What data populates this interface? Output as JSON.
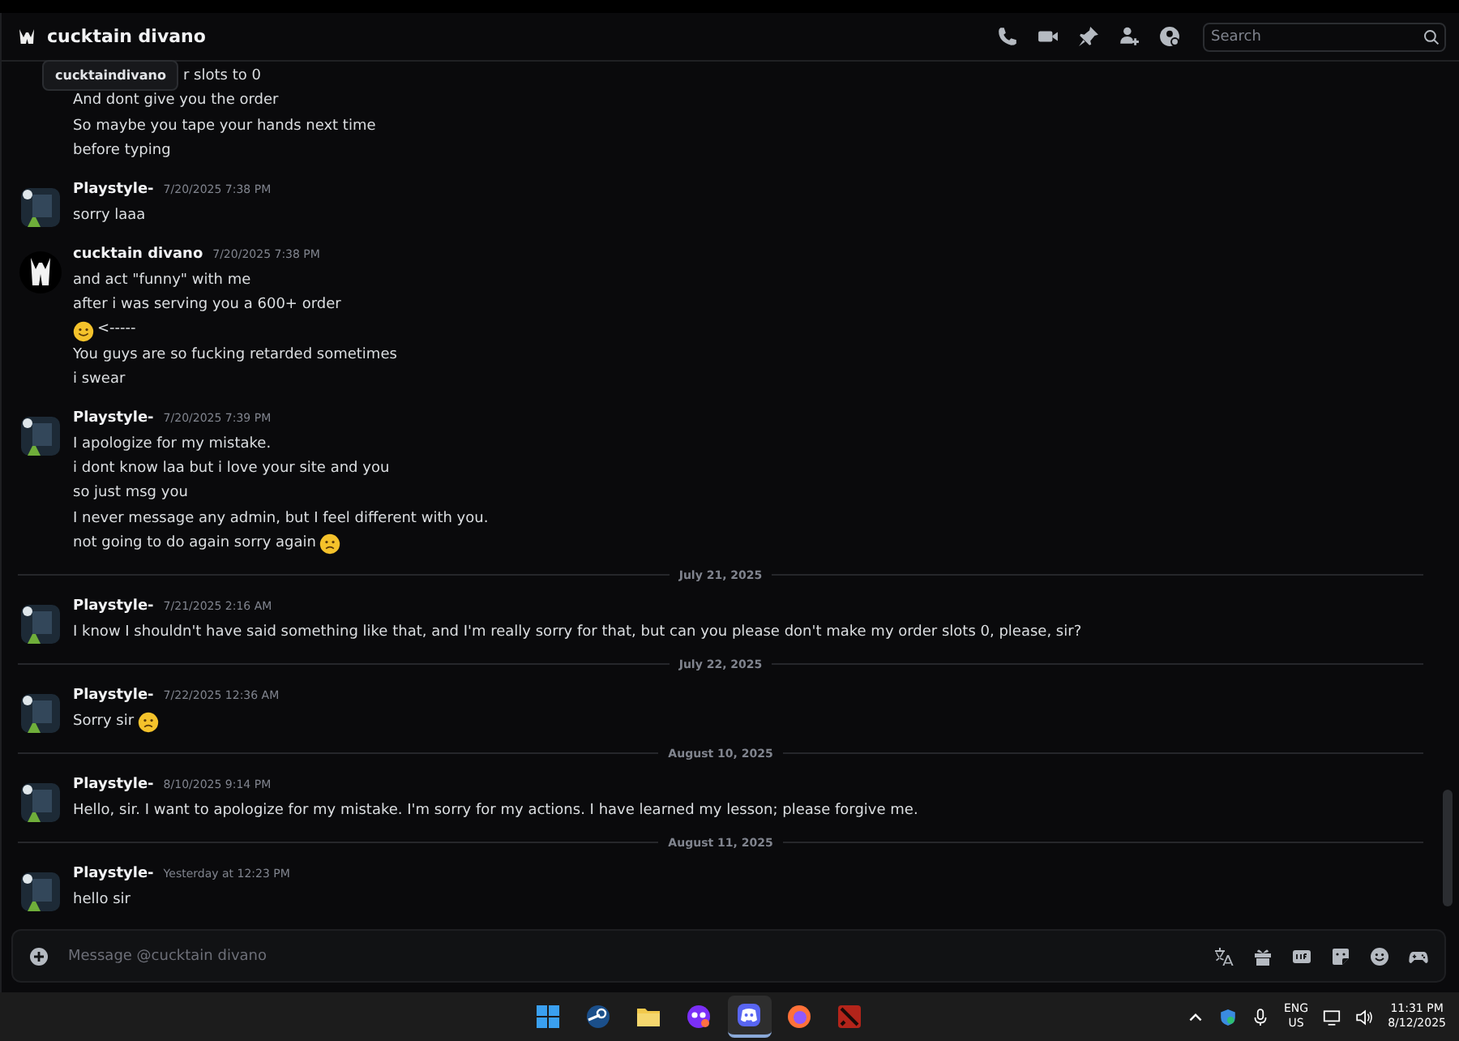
{
  "header": {
    "title": "cucktain divano",
    "tooltip": "cucktaindivano",
    "search": {
      "placeholder": "Search"
    }
  },
  "feed": [
    {
      "kind": "continuation",
      "lines": [
        {
          "text": "r slots to 0"
        },
        {
          "text": "And dont give you the order"
        },
        {
          "text": "So maybe you tape your hands next time"
        },
        {
          "text": "before typing"
        }
      ]
    },
    {
      "kind": "message",
      "avatar": {
        "kind": "art"
      },
      "author": "Playstyle-",
      "time": "7/20/2025 7:38 PM",
      "lines": [
        {
          "text": "sorry laaa"
        }
      ]
    },
    {
      "kind": "message",
      "avatar": {
        "kind": "figure"
      },
      "author": "cucktain divano",
      "time": "7/20/2025 7:38 PM",
      "lines": [
        {
          "text": "and act \"funny\" with me"
        },
        {
          "text": "after i was serving you a 600+ order"
        },
        {
          "kind": "smile_then_text",
          "text": "<-----"
        },
        {
          "text": "You guys are so fucking retarded sometimes"
        },
        {
          "text": "i swear"
        }
      ]
    },
    {
      "kind": "message",
      "avatar": {
        "kind": "art"
      },
      "author": "Playstyle-",
      "time": "7/20/2025 7:39 PM",
      "lines": [
        {
          "text": "I apologize for my mistake."
        },
        {
          "text": "i dont know laa but i love your site and you"
        },
        {
          "text": "so just msg you"
        },
        {
          "text": "I never message any admin, but I feel different with you."
        },
        {
          "kind": "text_then_frown",
          "text": "not going to do again sorry again"
        }
      ]
    },
    {
      "kind": "divider",
      "label": "July 21, 2025"
    },
    {
      "kind": "message",
      "avatar": {
        "kind": "art"
      },
      "author": "Playstyle-",
      "time": "7/21/2025 2:16 AM",
      "lines": [
        {
          "text": "I know I shouldn't have said something like that, and I'm really sorry for that, but can you please don't make my order slots 0, please, sir?"
        }
      ]
    },
    {
      "kind": "divider",
      "label": "July 22, 2025"
    },
    {
      "kind": "message",
      "avatar": {
        "kind": "art"
      },
      "author": "Playstyle-",
      "time": "7/22/2025 12:36 AM",
      "lines": [
        {
          "kind": "text_then_frown",
          "text": "Sorry sir"
        }
      ]
    },
    {
      "kind": "divider",
      "label": "August 10, 2025"
    },
    {
      "kind": "message",
      "avatar": {
        "kind": "art"
      },
      "author": "Playstyle-",
      "time": "8/10/2025 9:14 PM",
      "lines": [
        {
          "text": "Hello, sir. I want to apologize for my mistake. I'm sorry for my actions. I have learned my lesson; please forgive me."
        }
      ]
    },
    {
      "kind": "divider",
      "label": "August 11, 2025"
    },
    {
      "kind": "message",
      "avatar": {
        "kind": "art"
      },
      "author": "Playstyle-",
      "time": "Yesterday at 12:23 PM",
      "lines": [
        {
          "text": "hello sir"
        }
      ]
    }
  ],
  "composer": {
    "placeholder": "Message @cucktain divano"
  },
  "taskbar": {
    "apps": [
      {
        "kind": "start",
        "selected": false
      },
      {
        "kind": "steam",
        "selected": false
      },
      {
        "kind": "files",
        "selected": false
      },
      {
        "kind": "game",
        "selected": false
      },
      {
        "kind": "discord",
        "selected": true
      },
      {
        "kind": "firefox",
        "selected": false
      },
      {
        "kind": "dota",
        "selected": false
      }
    ],
    "language": "ENG",
    "region": "US",
    "time": "11:31 PM",
    "date": "8/12/2025"
  }
}
